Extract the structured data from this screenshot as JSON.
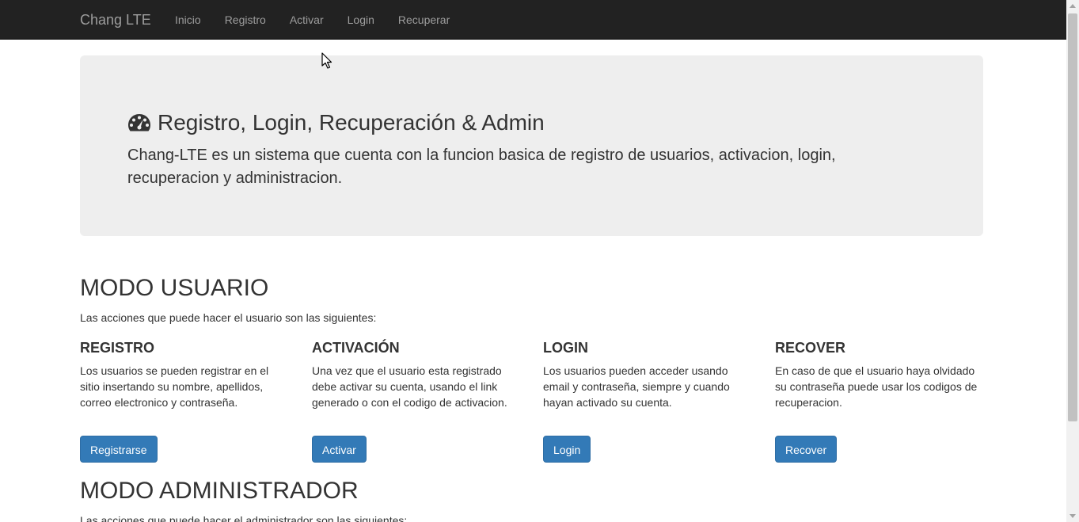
{
  "navbar": {
    "brand": "Chang LTE",
    "links": [
      "Inicio",
      "Registro",
      "Activar",
      "Login",
      "Recuperar"
    ]
  },
  "jumbotron": {
    "title": "Registro, Login, Recuperación & Admin",
    "text": "Chang-LTE es un sistema que cuenta con la funcion basica de registro de usuarios, activacion, login, recuperacion y administracion."
  },
  "user_mode": {
    "title": "MODO USUARIO",
    "subtitle": "Las acciones que puede hacer el usuario son las siguientes:",
    "columns": [
      {
        "title": "REGISTRO",
        "text": "Los usuarios se pueden registrar en el sitio insertando su nombre, apellidos, correo electronico y contraseña.",
        "button": "Registrarse"
      },
      {
        "title": "ACTIVACIÓN",
        "text": "Una vez que el usuario esta registrado debe activar su cuenta, usando el link generado o con el codigo de activacion.",
        "button": "Activar"
      },
      {
        "title": "LOGIN",
        "text": "Los usuarios pueden acceder usando email y contraseña, siempre y cuando hayan activado su cuenta.",
        "button": "Login"
      },
      {
        "title": "RECOVER",
        "text": "En caso de que el usuario haya olvidado su contraseña puede usar los codigos de recuperacion.",
        "button": "Recover"
      }
    ]
  },
  "admin_mode": {
    "title": "MODO ADMINISTRADOR",
    "subtitle": "Las acciones que puede hacer el administrador son las siguientes:"
  },
  "colors": {
    "navbar_bg": "#222222",
    "nav_text": "#9d9d9d",
    "jumbotron_bg": "#eeeeee",
    "button_primary": "#337ab7"
  },
  "icons": {
    "title_icon": "dashboard-icon"
  }
}
